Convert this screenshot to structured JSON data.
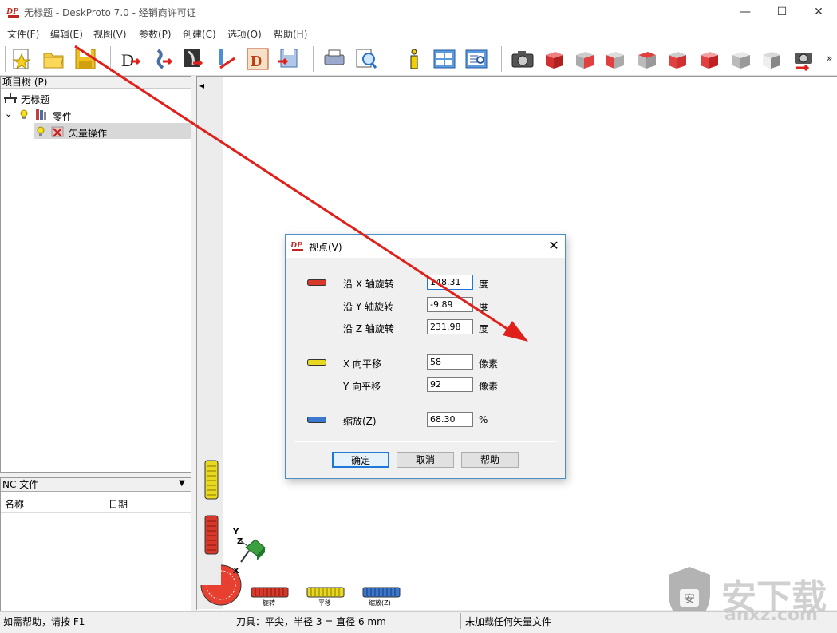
{
  "window": {
    "title": "无标题 - DeskProto 7.0 - 经销商许可证",
    "minimize": "—",
    "maximize": "☐",
    "close": "✕"
  },
  "menu": [
    "文件(F)",
    "编辑(E)",
    "视图(V)",
    "参数(P)",
    "创建(C)",
    "选项(O)",
    "帮助(H)"
  ],
  "toolbar": {
    "icons": [
      "new-project-icon",
      "open-folder-icon",
      "save-icon",
      "import-part-icon",
      "load-vector-icon",
      "load-bitmap-icon",
      "tool-path-icon",
      "drawing-icon",
      "save-nc-icon",
      "print-icon",
      "print-preview-icon",
      "info-icon",
      "window-layout-icon",
      "view-list-icon",
      "camera-icon",
      "view-front-icon",
      "view-back-icon",
      "view-left-icon",
      "view-right-icon",
      "view-top-icon",
      "view-bottom-icon",
      "view-iso-icon",
      "view-iso2-icon",
      "camera-reset-icon"
    ],
    "overflow": "»"
  },
  "tree": {
    "header": "项目树 (P)",
    "root": "无标题",
    "part": "零件",
    "vector_op": "矢量操作"
  },
  "nc": {
    "header": "NC 文件",
    "col_name": "名称",
    "col_date": "日期"
  },
  "viewport": {
    "collapse_arrow": "◂",
    "axis_y": "Y",
    "axis_z": "Z",
    "axis_x": "X",
    "dial_rotate": "旋转",
    "dial_pan": "平移",
    "dial_zoom": "缩放(Z)"
  },
  "dialog": {
    "title": "视点(V)",
    "rot_x_label": "沿 X 轴旋转",
    "rot_x_value": "148.31",
    "rot_y_label": "沿 Y 轴旋转",
    "rot_y_value": "-9.89",
    "rot_z_label": "沿 Z 轴旋转",
    "rot_z_value": "231.98",
    "deg_unit": "度",
    "pan_x_label": "X 向平移",
    "pan_x_value": "58",
    "pan_y_label": "Y 向平移",
    "pan_y_value": "92",
    "pixel_unit": "像素",
    "zoom_label": "缩放(Z)",
    "zoom_value": "68.30",
    "pct_unit": "%",
    "ok": "确定",
    "cancel": "取消",
    "help": "帮助"
  },
  "status": {
    "help_hint": "如需帮助，请按 F1",
    "tool_info": "刀具：平尖，半径 3 = 直径 6 mm",
    "vector_info": "未加载任何矢量文件"
  },
  "watermark": {
    "text": "安下载",
    "url": "anxz.com"
  },
  "colors": {
    "accent": "#1e78d7",
    "arrow": "#e0201a",
    "dial_red": "#d8382a",
    "dial_yellow": "#e8d820",
    "dial_blue": "#3a78d0"
  }
}
